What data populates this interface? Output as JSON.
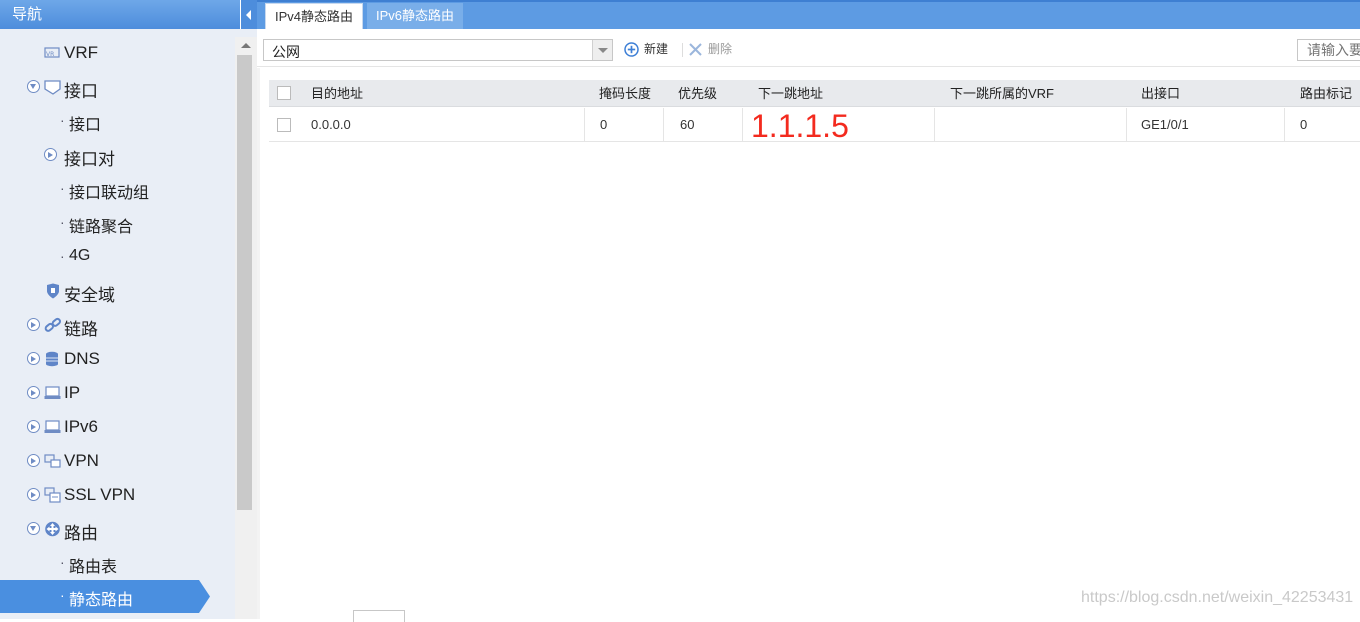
{
  "sidebar": {
    "header": "导航",
    "items": [
      {
        "label": "VRF",
        "icon": "vrf-icon"
      },
      {
        "label": "接口",
        "icon": "interface-icon",
        "expanded": true
      },
      {
        "label": "接口",
        "sub": true
      },
      {
        "label": "接口对",
        "expander": true
      },
      {
        "label": "接口联动组",
        "sub": true
      },
      {
        "label": "链路聚合",
        "sub": true
      },
      {
        "label": "4G",
        "sub": true
      },
      {
        "label": "安全域",
        "icon": "shield-icon"
      },
      {
        "label": "链路",
        "icon": "link-icon"
      },
      {
        "label": "DNS",
        "icon": "database-icon"
      },
      {
        "label": "IP",
        "icon": "network-card-icon"
      },
      {
        "label": "IPv6",
        "icon": "network-card-icon"
      },
      {
        "label": "VPN",
        "icon": "vpn-icon"
      },
      {
        "label": "SSL VPN",
        "icon": "ssl-vpn-icon"
      },
      {
        "label": "路由",
        "icon": "router-icon",
        "expanded": true
      },
      {
        "label": "路由表",
        "sub": true
      },
      {
        "label": "静态路由",
        "sub": true,
        "selected": true
      }
    ]
  },
  "tabs": [
    {
      "label": "IPv4静态路由",
      "active": true
    },
    {
      "label": "IPv6静态路由",
      "active": false
    }
  ],
  "toolbar": {
    "vrf_value": "公网",
    "new_label": "新建",
    "delete_label": "删除",
    "search_placeholder": "请输入要"
  },
  "table": {
    "columns": [
      "目的地址",
      "掩码长度",
      "优先级",
      "下一跳地址",
      "下一跳所属的VRF",
      "出接口",
      "路由标记"
    ],
    "rows": [
      {
        "dest": "0.0.0.0",
        "mask": "0",
        "priority": "60",
        "nexthop": "1.1.1.5",
        "nexthop_vrf": "",
        "out_if": "GE1/0/1",
        "tag": "0"
      }
    ]
  },
  "watermark": "https://blog.csdn.net/weixin_42253431",
  "colors": {
    "nav_selected": "#4a8fe0",
    "tabbar": "#5d9be3",
    "nexthop_text": "#f32a1e"
  }
}
